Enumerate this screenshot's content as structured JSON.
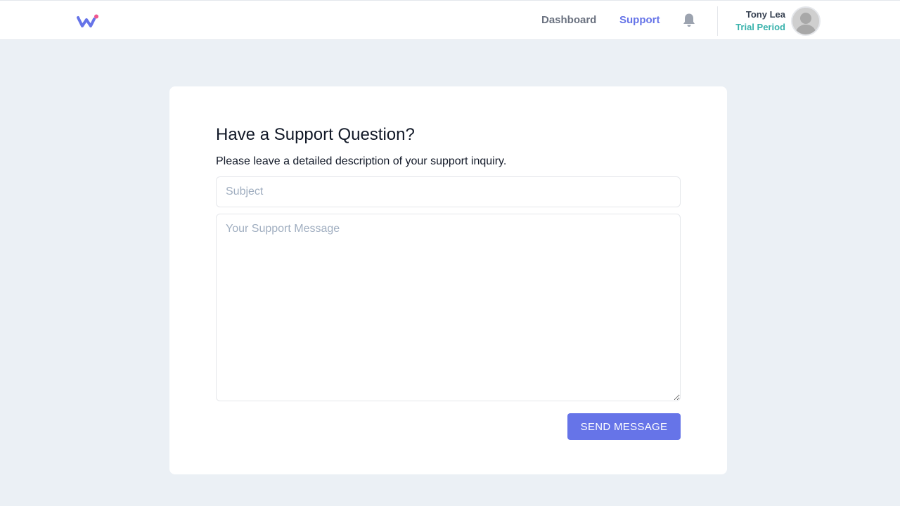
{
  "header": {
    "logo_icon": "w-logo-icon",
    "nav": [
      {
        "label": "Dashboard",
        "active": false
      },
      {
        "label": "Support",
        "active": true
      }
    ],
    "notification_icon": "bell-icon",
    "user": {
      "name": "Tony Lea",
      "plan": "Trial Period",
      "avatar_icon": "user-avatar"
    }
  },
  "form": {
    "title": "Have a Support Question?",
    "description": "Please leave a detailed description of your support inquiry.",
    "subject_placeholder": "Subject",
    "subject_value": "",
    "message_placeholder": "Your Support Message",
    "message_value": "",
    "submit_label": "SEND MESSAGE"
  },
  "colors": {
    "accent": "#6674e8",
    "trial": "#38b2ac",
    "background": "#ebf0f5",
    "logo_dot": "#f0568f"
  }
}
